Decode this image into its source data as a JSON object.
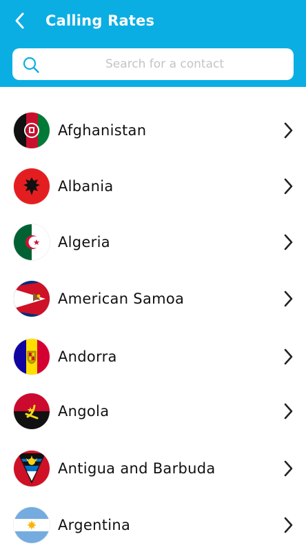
{
  "header": {
    "title": "Calling Rates",
    "back_icon": "chevron-left-icon",
    "background": "#0aaee3"
  },
  "search": {
    "placeholder": "Search for a contact",
    "value": "",
    "icon": "search-icon"
  },
  "countries": [
    {
      "name": "Afghanistan",
      "flag": "flag-afghanistan-icon"
    },
    {
      "name": "Albania",
      "flag": "flag-albania-icon"
    },
    {
      "name": "Algeria",
      "flag": "flag-algeria-icon"
    },
    {
      "name": "American Samoa",
      "flag": "flag-american-samoa-icon"
    },
    {
      "name": "Andorra",
      "flag": "flag-andorra-icon"
    },
    {
      "name": "Angola",
      "flag": "flag-angola-icon"
    },
    {
      "name": "Antigua and Barbuda",
      "flag": "flag-antigua-and-barbuda-icon"
    },
    {
      "name": "Argentina",
      "flag": "flag-argentina-icon"
    }
  ],
  "row_chevron_icon": "chevron-right-icon"
}
